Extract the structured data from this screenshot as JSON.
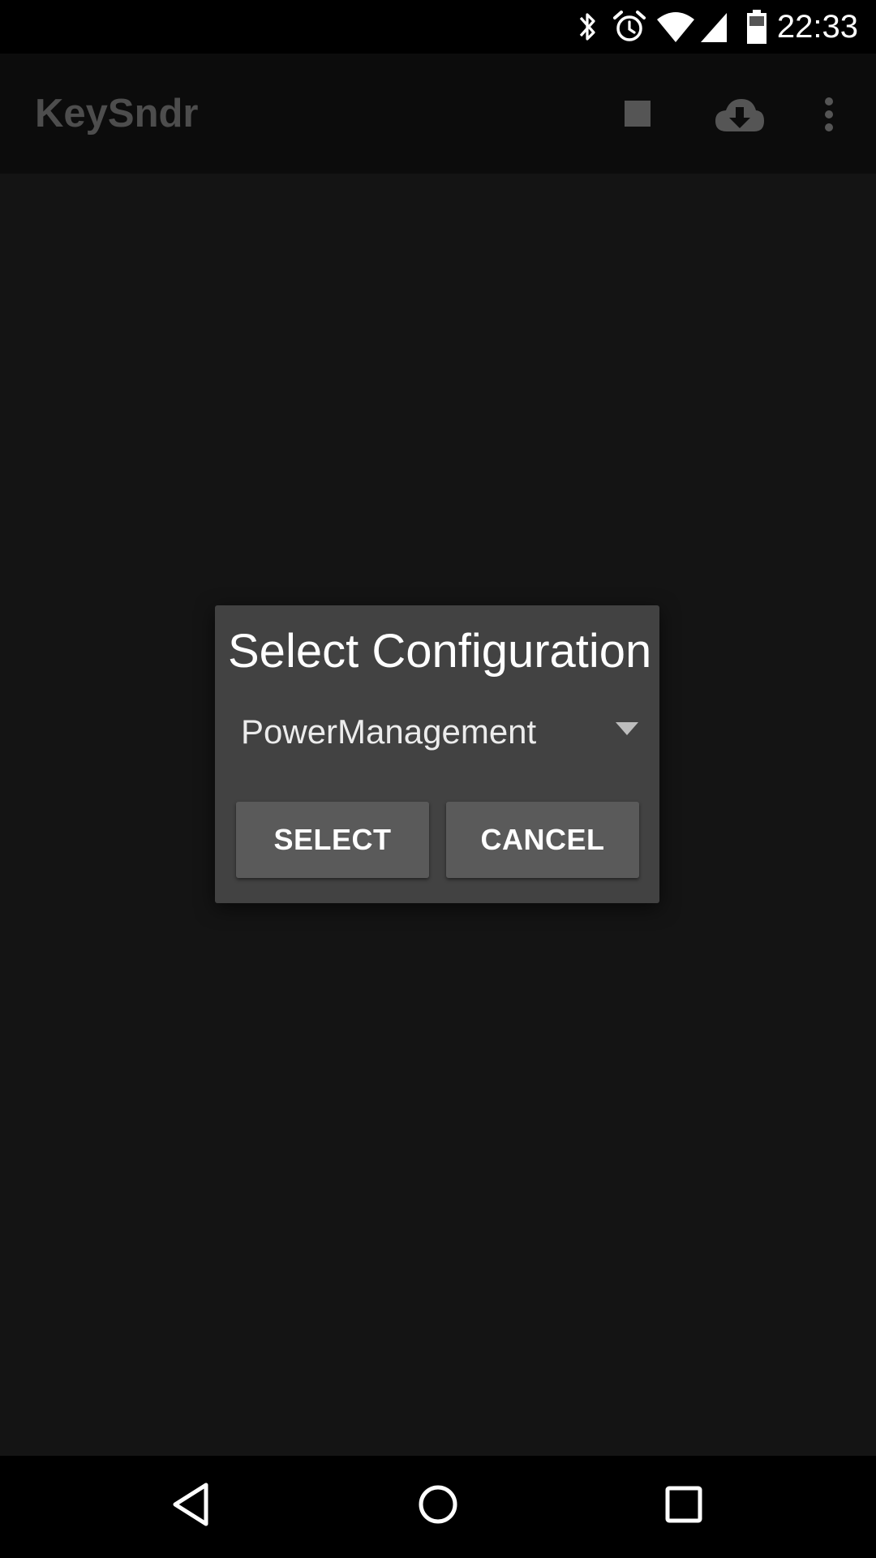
{
  "status_bar": {
    "time": "22:33",
    "icons": [
      "bluetooth-icon",
      "alarm-icon",
      "wifi-icon",
      "signal-icon",
      "battery-icon"
    ]
  },
  "app_bar": {
    "title": "KeySndr",
    "actions": [
      "stop-icon",
      "cloud-download-icon",
      "more-vert-icon"
    ]
  },
  "dialog": {
    "title": "Select Configuration",
    "spinner_value": "PowerManagement",
    "select_label": "SELECT",
    "cancel_label": "CANCEL"
  },
  "nav_bar": {
    "buttons": [
      "back-icon",
      "home-icon",
      "recents-icon"
    ]
  },
  "colors": {
    "background": "#141414",
    "app_bar": "#0c0c0c",
    "dialog": "#424242",
    "button": "#5a5a5a",
    "title_dim": "#4d4d4d"
  }
}
